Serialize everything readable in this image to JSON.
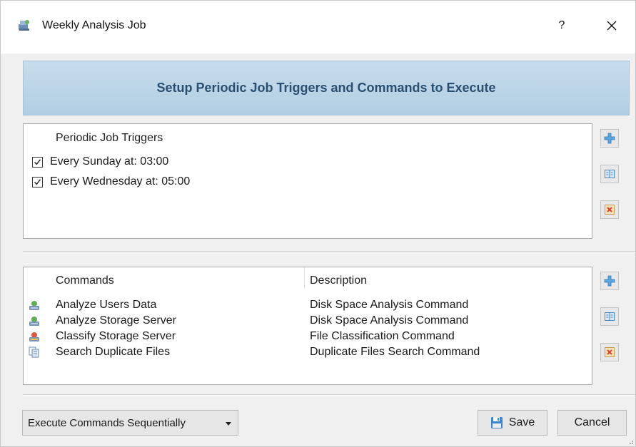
{
  "window": {
    "title": "Weekly Analysis Job",
    "help_label": "?",
    "close_icon": "close-icon"
  },
  "banner": {
    "text": "Setup Periodic Job Triggers and Commands to Execute"
  },
  "triggers": {
    "header": "Periodic Job Triggers",
    "items": [
      {
        "label": "Every Sunday at: 03:00",
        "checked": true
      },
      {
        "label": "Every Wednesday at: 05:00",
        "checked": true
      }
    ]
  },
  "commands": {
    "headers": {
      "name": "Commands",
      "description": "Description"
    },
    "items": [
      {
        "name": "Analyze Users Data",
        "description": "Disk Space Analysis Command",
        "icon": "disk-analysis-icon"
      },
      {
        "name": "Analyze Storage Server",
        "description": "Disk Space Analysis Command",
        "icon": "disk-analysis-icon"
      },
      {
        "name": "Classify Storage Server",
        "description": "File Classification Command",
        "icon": "file-classification-icon"
      },
      {
        "name": "Search Duplicate Files",
        "description": "Duplicate Files Search Command",
        "icon": "duplicate-files-icon"
      }
    ]
  },
  "side_buttons": {
    "add_icon": "plus-icon",
    "edit_icon": "edit-icon",
    "delete_icon": "delete-icon"
  },
  "footer": {
    "execution_mode": "Execute Commands Sequentially",
    "save_label": "Save",
    "cancel_label": "Cancel"
  },
  "colors": {
    "banner_text": "#2b4f70",
    "banner_bg": "#bdd5e8",
    "add_icon": "#4a9ad6",
    "delete_icon": "#d9532c"
  }
}
